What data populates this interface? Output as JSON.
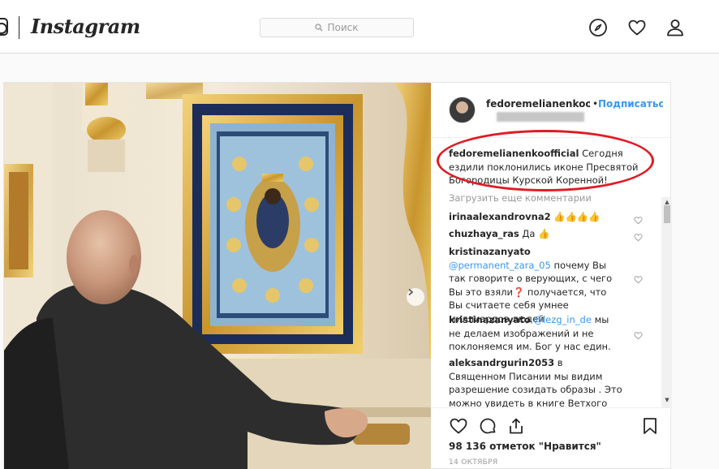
{
  "nav": {
    "logo": "Instagram",
    "search_placeholder": "Поиск",
    "icons": [
      "camera-icon",
      "compass-icon",
      "heart-icon",
      "user-icon"
    ]
  },
  "post": {
    "username": "fedoremelianenkoofficial",
    "separator": "•",
    "follow_label": "Подписаться",
    "caption": {
      "user": "fedoremelianenkoofficial",
      "text": "Сегодня ездили поклонились иконе Пресвятой Богородицы Курской Коренной!"
    },
    "load_more": "Загрузить еще комментарии",
    "comments": [
      {
        "user": "irinaalexandrovna2",
        "mention": "",
        "text": "👍👍👍👍"
      },
      {
        "user": "chuzhaya_ras",
        "mention": "",
        "text": "Да 👍"
      },
      {
        "user": "kristinazanyato",
        "mention": "@permanent_zara_05",
        "text": "почему Вы так говорите о верующих, с чего Вы это взяли❓ получается, что Вы считаете себя умнее миллиардов людей"
      },
      {
        "user": "kristinazanyato",
        "mention": "@lezg_in_de",
        "text": "мы не делаем изображений и не поклоняемся им. Бог у нас един."
      },
      {
        "user": "aleksandrgurin2053",
        "mention": "",
        "text": "в Священном Писании мы видим разрешение созидать образы . Это можно увидеть в книге Ветхого Завета -"
      }
    ],
    "likes": "98 136 отметок \"Нравится\"",
    "date": "14 ОКТЯБРЯ",
    "accent_color": "#3897f0",
    "annotation_color": "#e01b24"
  }
}
